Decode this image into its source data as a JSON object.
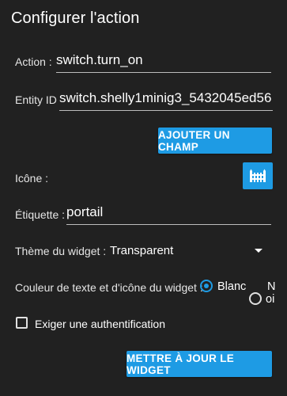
{
  "dialog": {
    "title": "Configurer l'action"
  },
  "form": {
    "action": {
      "label": "Action :",
      "value": "switch.turn_on"
    },
    "entity_id": {
      "label": "Entity ID",
      "value": "switch.shelly1minig3_5432045ed56"
    },
    "add_field_button": "AJOUTER UN CHAMP",
    "icon": {
      "label": "Icône :",
      "icon_name": "gate-icon"
    },
    "tag": {
      "label": "Étiquette :",
      "value": "portail"
    },
    "widget_theme": {
      "label": "Thème du widget :",
      "selected": "Transparent"
    },
    "text_icon_color": {
      "label": "Couleur de texte et d'icône du widget :",
      "options": [
        {
          "label": "Blanc",
          "checked": true
        },
        {
          "label_line1": "N",
          "label_line2": "oi",
          "checked": false
        }
      ]
    },
    "require_auth": {
      "label": "Exiger une authentification",
      "checked": false
    }
  },
  "footer": {
    "update_button": "METTRE À JOUR LE WIDGET"
  },
  "colors": {
    "background": "#212121",
    "accent": "#1e9be4",
    "text": "#ffffff"
  }
}
